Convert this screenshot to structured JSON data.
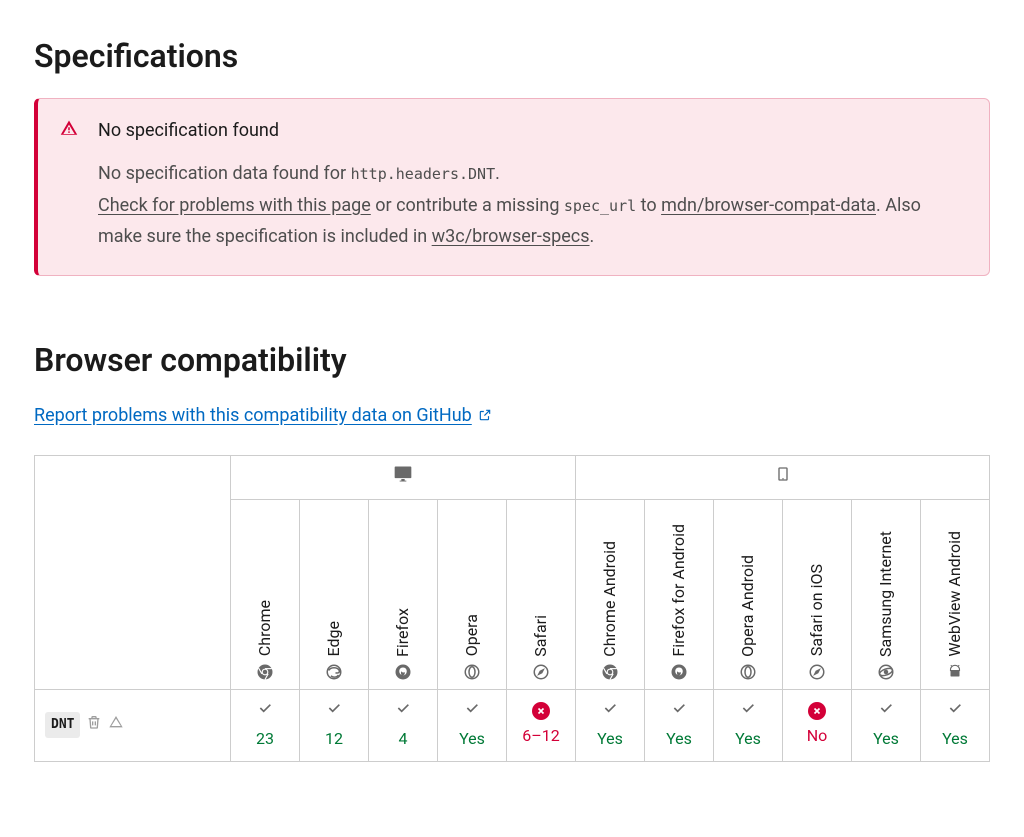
{
  "specs": {
    "heading": "Specifications",
    "notecard": {
      "title": "No specification found",
      "intro": "No specification data found for ",
      "code1": "http.headers.DNT",
      "text1_suffix": ".",
      "link1": "Check for problems with this page",
      "text2": " or contribute a missing ",
      "code2": "spec_url",
      "text3": " to ",
      "link2": "mdn/browser-compat-data",
      "text4": ". Also make sure the specification is included in ",
      "link3": "w3c/browser-specs",
      "text5": "."
    }
  },
  "compat": {
    "heading": "Browser compatibility",
    "report_link": "Report problems with this compatibility data on GitHub",
    "platforms": {
      "desktop_span": 5,
      "mobile_span": 6
    },
    "browsers": [
      {
        "name": "Chrome",
        "platform": "desktop",
        "icon": "chrome"
      },
      {
        "name": "Edge",
        "platform": "desktop",
        "icon": "edge"
      },
      {
        "name": "Firefox",
        "platform": "desktop",
        "icon": "firefox"
      },
      {
        "name": "Opera",
        "platform": "desktop",
        "icon": "opera"
      },
      {
        "name": "Safari",
        "platform": "desktop",
        "icon": "safari"
      },
      {
        "name": "Chrome Android",
        "platform": "mobile",
        "icon": "chrome"
      },
      {
        "name": "Firefox for Android",
        "platform": "mobile",
        "icon": "firefox"
      },
      {
        "name": "Opera Android",
        "platform": "mobile",
        "icon": "opera"
      },
      {
        "name": "Safari on iOS",
        "platform": "mobile",
        "icon": "safari"
      },
      {
        "name": "Samsung Internet",
        "platform": "mobile",
        "icon": "samsung"
      },
      {
        "name": "WebView Android",
        "platform": "mobile",
        "icon": "android"
      }
    ],
    "row": {
      "feature": "DNT",
      "deprecated": true,
      "nonstandard": true,
      "support": [
        {
          "status": "yes",
          "version": "23"
        },
        {
          "status": "yes",
          "version": "12"
        },
        {
          "status": "yes",
          "version": "4"
        },
        {
          "status": "yes",
          "version": "Yes"
        },
        {
          "status": "no",
          "version": "6–12"
        },
        {
          "status": "yes",
          "version": "Yes"
        },
        {
          "status": "yes",
          "version": "Yes"
        },
        {
          "status": "yes",
          "version": "Yes"
        },
        {
          "status": "no",
          "version": "No"
        },
        {
          "status": "yes",
          "version": "Yes"
        },
        {
          "status": "yes",
          "version": "Yes"
        }
      ]
    }
  }
}
